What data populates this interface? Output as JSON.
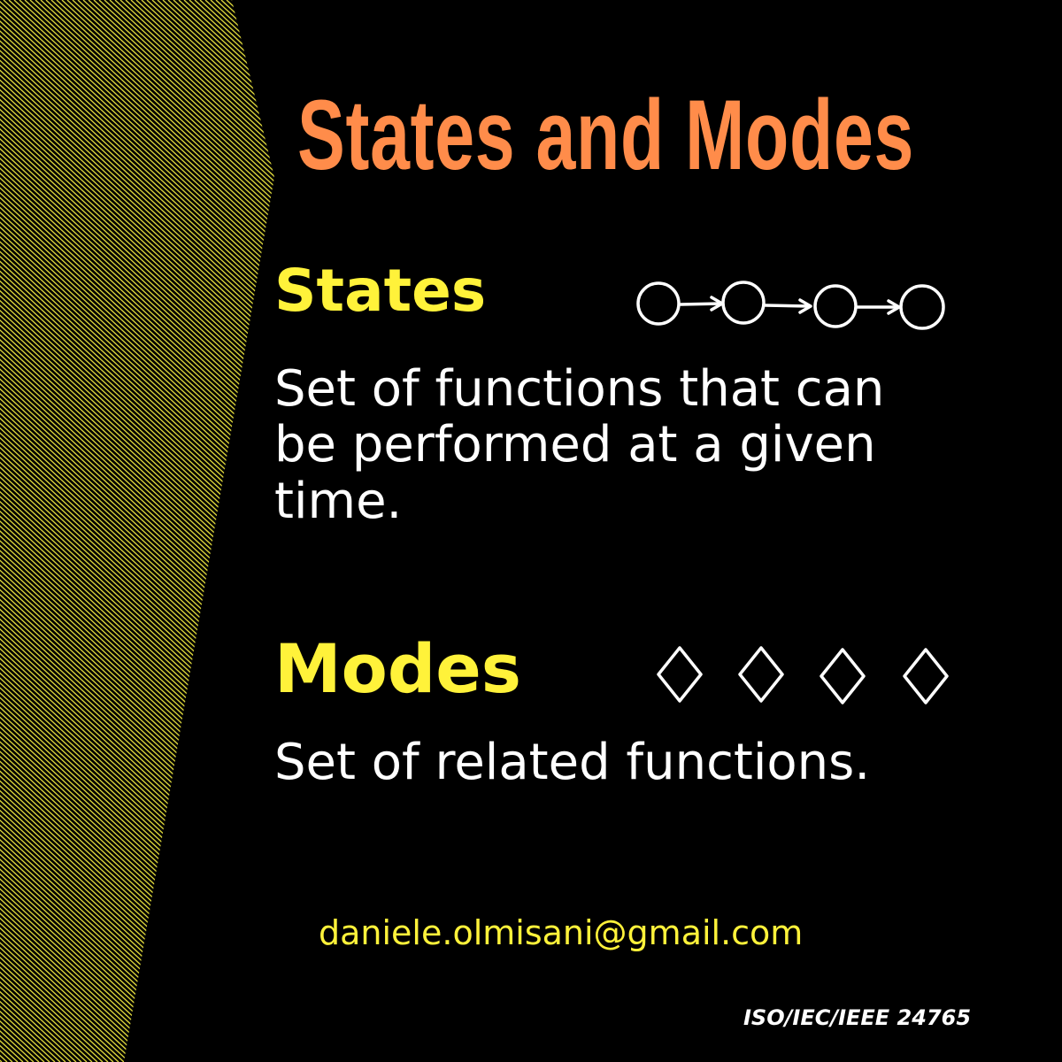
{
  "title": "States and Modes",
  "colors": {
    "background": "#000000",
    "title": "#FF8C4A",
    "heading": "#FFF23A",
    "body": "#FFFFFF",
    "stripes": "#D8D23A"
  },
  "states": {
    "heading": "States",
    "description": "Set of functions that can be performed at a given time.",
    "icon": "state-chain-icon"
  },
  "modes": {
    "heading": "Modes",
    "description": "Set of related functions.",
    "icon": "diamond-row-icon"
  },
  "footer": {
    "email": "daniele.olmisani@gmail.com",
    "standard": "ISO/IEC/IEEE 24765"
  }
}
